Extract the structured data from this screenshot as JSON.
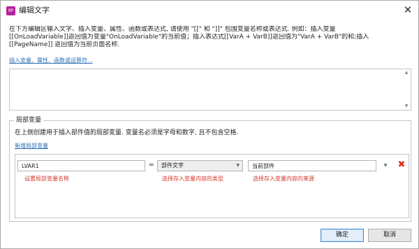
{
  "window": {
    "app_icon_text": "RP",
    "title": "编辑文字"
  },
  "description": {
    "line1": "在下方编辑区输入文字、插入变量、属性、函数或表达式, 请使用 \"[[\" 和 \"]]\" 包围变量名称或表达式. 例如：插入变量",
    "line2": "[[OnLoadVariable]]返回值为变量\"OnLoadVariable\"的当前值；插入表达式[[VarA + VarB]]返回值为\"VarA + VarB\"的和;插入",
    "line3": "[[PageName]] 返回值为当前页面名称."
  },
  "insert_link": "插入变量、属性、函数或运算符...",
  "expression": {
    "value": ""
  },
  "local_vars": {
    "group_title": "局部变量",
    "description": "在上侧创建用于插入部件值的局部变量. 变量名必须是字母和数字, 且不包含空格.",
    "new_link": "新增局部变量",
    "rows": [
      {
        "name": "LVAR1",
        "equals": "=",
        "type": "部件文字",
        "source": "当前部件",
        "hint_name": "设置局部变量名称",
        "hint_type": "选择存入变量内容的类型",
        "hint_source": "选择存入变量内容的来源"
      }
    ]
  },
  "buttons": {
    "ok": "确定",
    "cancel": "取消"
  },
  "colors": {
    "link": "#2b6fb5",
    "hint": "#d9362b",
    "delete": "#e0301e",
    "app_icon": "#b8209b",
    "ok_border": "#3c8ad8"
  },
  "icons": {
    "close": "close-icon",
    "delete": "x-delete-icon",
    "dropdown": "triangle-down-icon",
    "scroll_up": "triangle-up-icon",
    "scroll_down": "triangle-down-icon"
  }
}
